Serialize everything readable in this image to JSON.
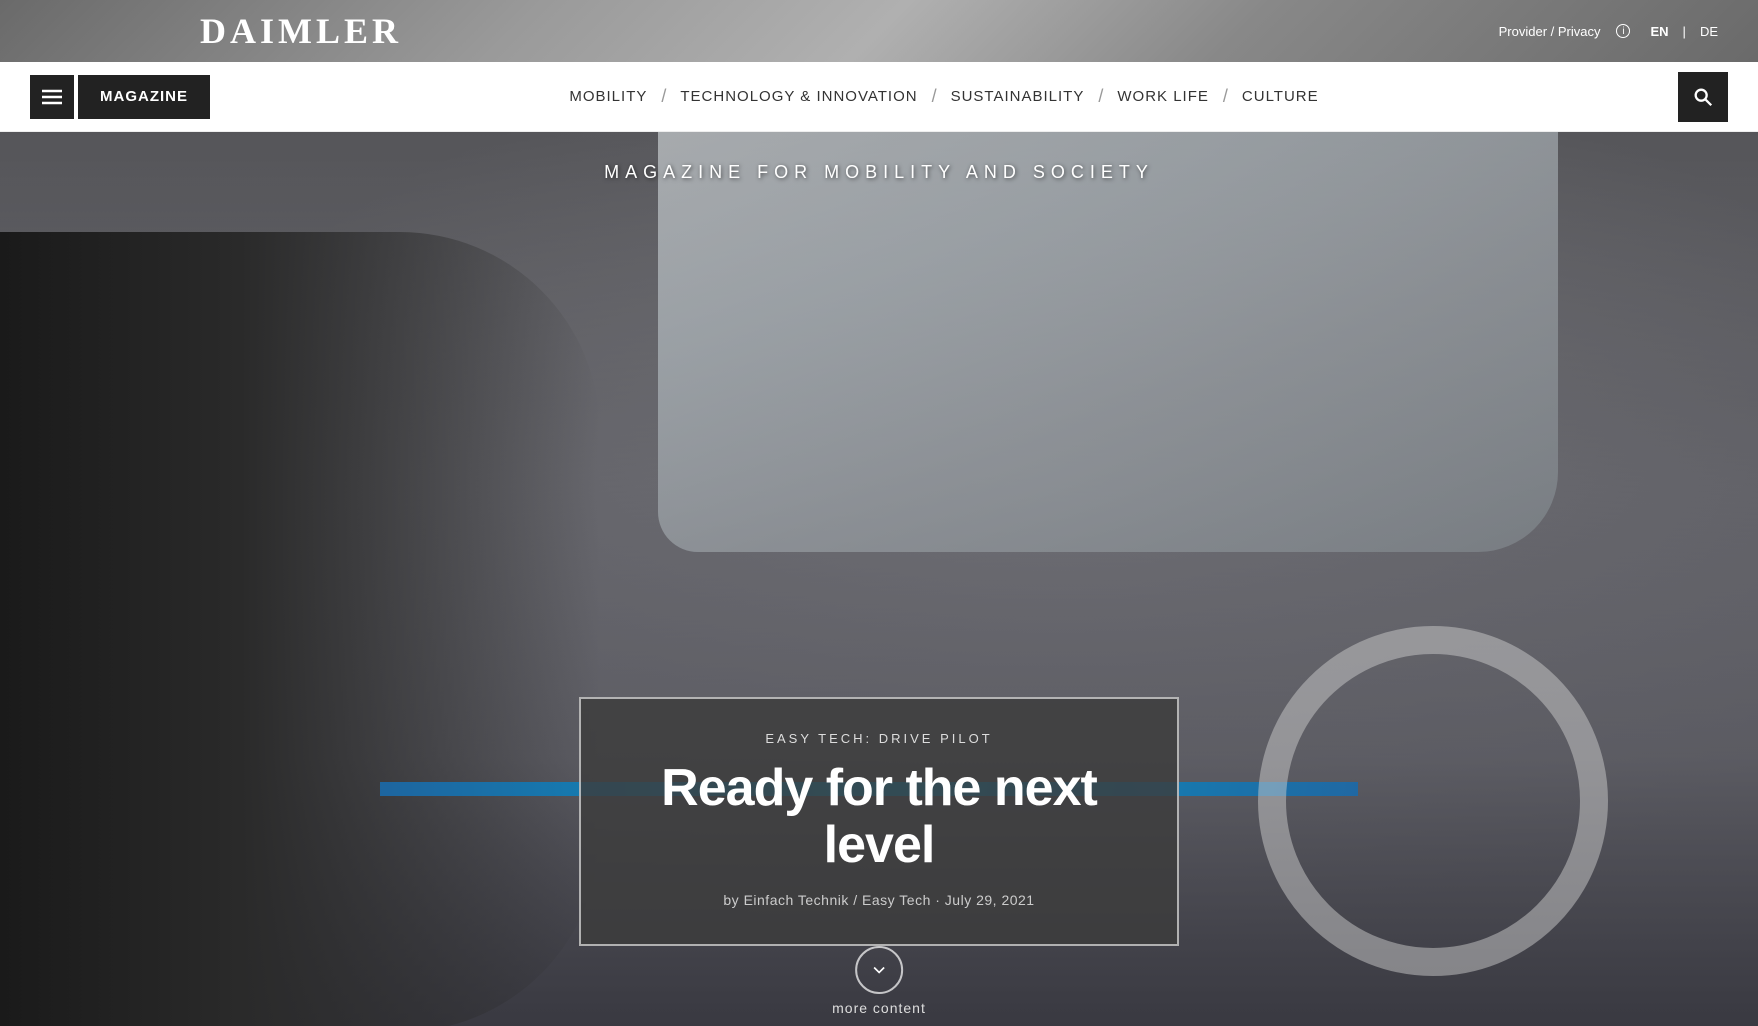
{
  "topbar": {
    "logo": "DAIMLER",
    "provider_privacy": "Provider / Privacy",
    "lang_en": "EN",
    "lang_separator": "|",
    "lang_de": "DE"
  },
  "navbar": {
    "hamburger_icon": "☰",
    "magazine_label": "MAGAZINE",
    "nav_items": [
      {
        "label": "MOBILITY",
        "id": "mobility"
      },
      {
        "label": "TECHNOLOGY & INNOVATION",
        "id": "tech-innovation"
      },
      {
        "label": "SUSTAINABILITY",
        "id": "sustainability"
      },
      {
        "label": "WORK LIFE",
        "id": "work-life"
      },
      {
        "label": "CULTURE",
        "id": "culture"
      }
    ]
  },
  "hero": {
    "subtitle": "MAGAZINE FOR MOBILITY AND SOCIETY",
    "card": {
      "category": "EASY TECH: DRIVE PILOT",
      "title": "Ready for the next level",
      "meta": "by Einfach Technik / Easy Tech · July 29, 2021"
    },
    "more_content_label": "more content"
  }
}
